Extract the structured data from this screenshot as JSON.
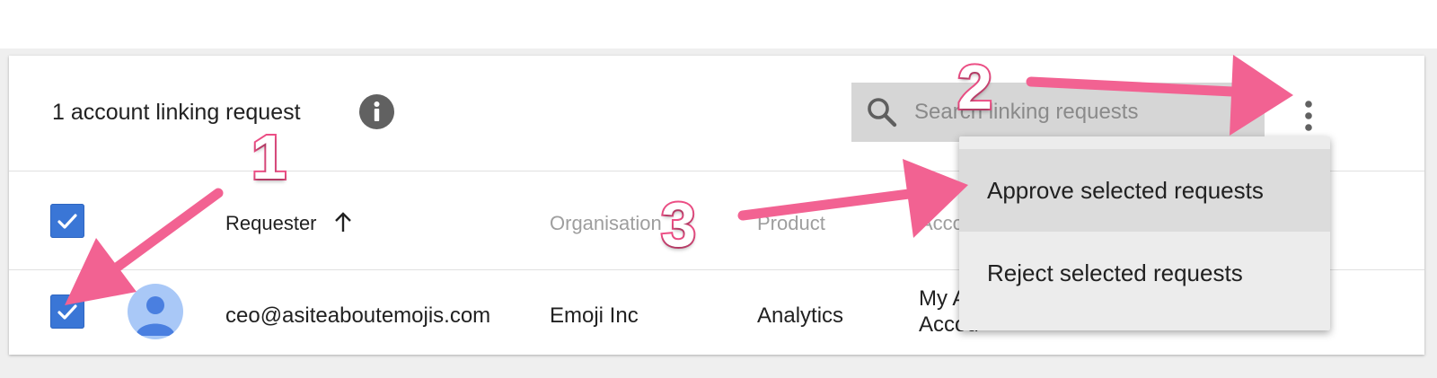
{
  "header": {
    "title": "1 account linking request",
    "search": {
      "placeholder": "Search linking requests",
      "value": ""
    }
  },
  "table": {
    "columns": [
      "Requester",
      "Organisation",
      "Product",
      "Acco"
    ],
    "sorted_column": "Requester",
    "sort_direction": "ascending",
    "select_all_checked": true,
    "rows": [
      {
        "checked": true,
        "requester": "ceo@asiteaboutemojis.com",
        "organisation": "Emoji Inc",
        "product": "Analytics",
        "account_line1": "My A",
        "account_line2": "Accou"
      }
    ]
  },
  "menu": {
    "items": [
      {
        "label": "Approve selected requests",
        "highlighted": true
      },
      {
        "label": "Reject selected requests",
        "highlighted": false
      }
    ]
  },
  "annotations": {
    "steps": [
      "1",
      "2",
      "3"
    ],
    "color": "#f26292"
  },
  "colors": {
    "checkbox": "#3a76d6",
    "search_bg": "#d6d6d6",
    "menu_bg": "#ececec",
    "menu_highlight": "#dcdcdc",
    "avatar_bg": "#a9c8f7",
    "avatar_figure": "#4a7fe0"
  }
}
